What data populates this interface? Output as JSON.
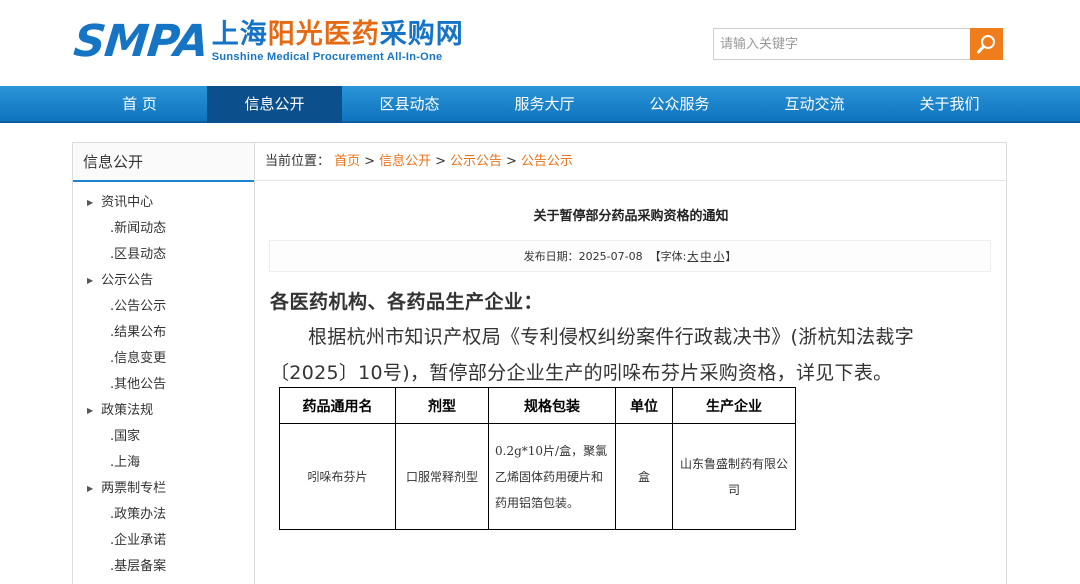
{
  "header": {
    "logo_main": "SMPA",
    "logo_cn_a": "上海",
    "logo_cn_b": "阳光医药",
    "logo_cn_c": "采购网",
    "logo_en": "Sunshine Medical Procurement All-In-One",
    "search_placeholder": "请输入关键字",
    "search_icon": "search-icon"
  },
  "colors": {
    "brand_blue": "#1674c6",
    "accent_orange": "#f07d1c",
    "nav_blue": "#1683cb",
    "nav_active": "#0b4f8c",
    "link_orange": "#e8731a"
  },
  "nav": {
    "items": [
      "首 页",
      "信息公开",
      "区县动态",
      "服务大厅",
      "公众服务",
      "互动交流",
      "关于我们"
    ],
    "active_index": 1
  },
  "sidebar": {
    "title": "信息公开",
    "groups": [
      {
        "label": "资讯中心",
        "items": [
          ".新闻动态",
          ".区县动态"
        ]
      },
      {
        "label": "公示公告",
        "items": [
          ".公告公示",
          ".结果公布",
          ".信息变更",
          ".其他公告"
        ]
      },
      {
        "label": "政策法规",
        "items": [
          ".国家",
          ".上海"
        ]
      },
      {
        "label": "两票制专栏",
        "items": [
          ".政策办法",
          ".企业承诺",
          ".基层备案"
        ]
      }
    ]
  },
  "breadcrumb": {
    "prefix": "当前位置：",
    "items": [
      "首页",
      "信息公开",
      "公示公告",
      "公告公示"
    ],
    "separator": ">"
  },
  "article": {
    "title": "关于暂停部分药品采购资格的通知",
    "date_label": "发布日期：",
    "date": "2025-07-08",
    "font_label_open": "【字体:",
    "font_big": "大",
    "font_mid": "中",
    "font_small": "小",
    "font_label_close": "】",
    "greeting": "各医药机构、各药品生产企业：",
    "paragraph": "根据杭州市知识产权局《专利侵权纠纷案件行政裁决书》(浙杭知法裁字〔2025〕10号)，暂停部分企业生产的吲哚布芬片采购资格，详见下表。"
  },
  "table": {
    "headers": [
      "药品通用名",
      "剂型",
      "规格包装",
      "单位",
      "生产企业"
    ],
    "rows": [
      [
        "吲哚布芬片",
        "口服常释剂型",
        "0.2g*10片/盒，聚氯乙烯固体药用硬片和药用铝箔包装。",
        "盒",
        "山东鲁盛制药有限公司"
      ]
    ]
  }
}
